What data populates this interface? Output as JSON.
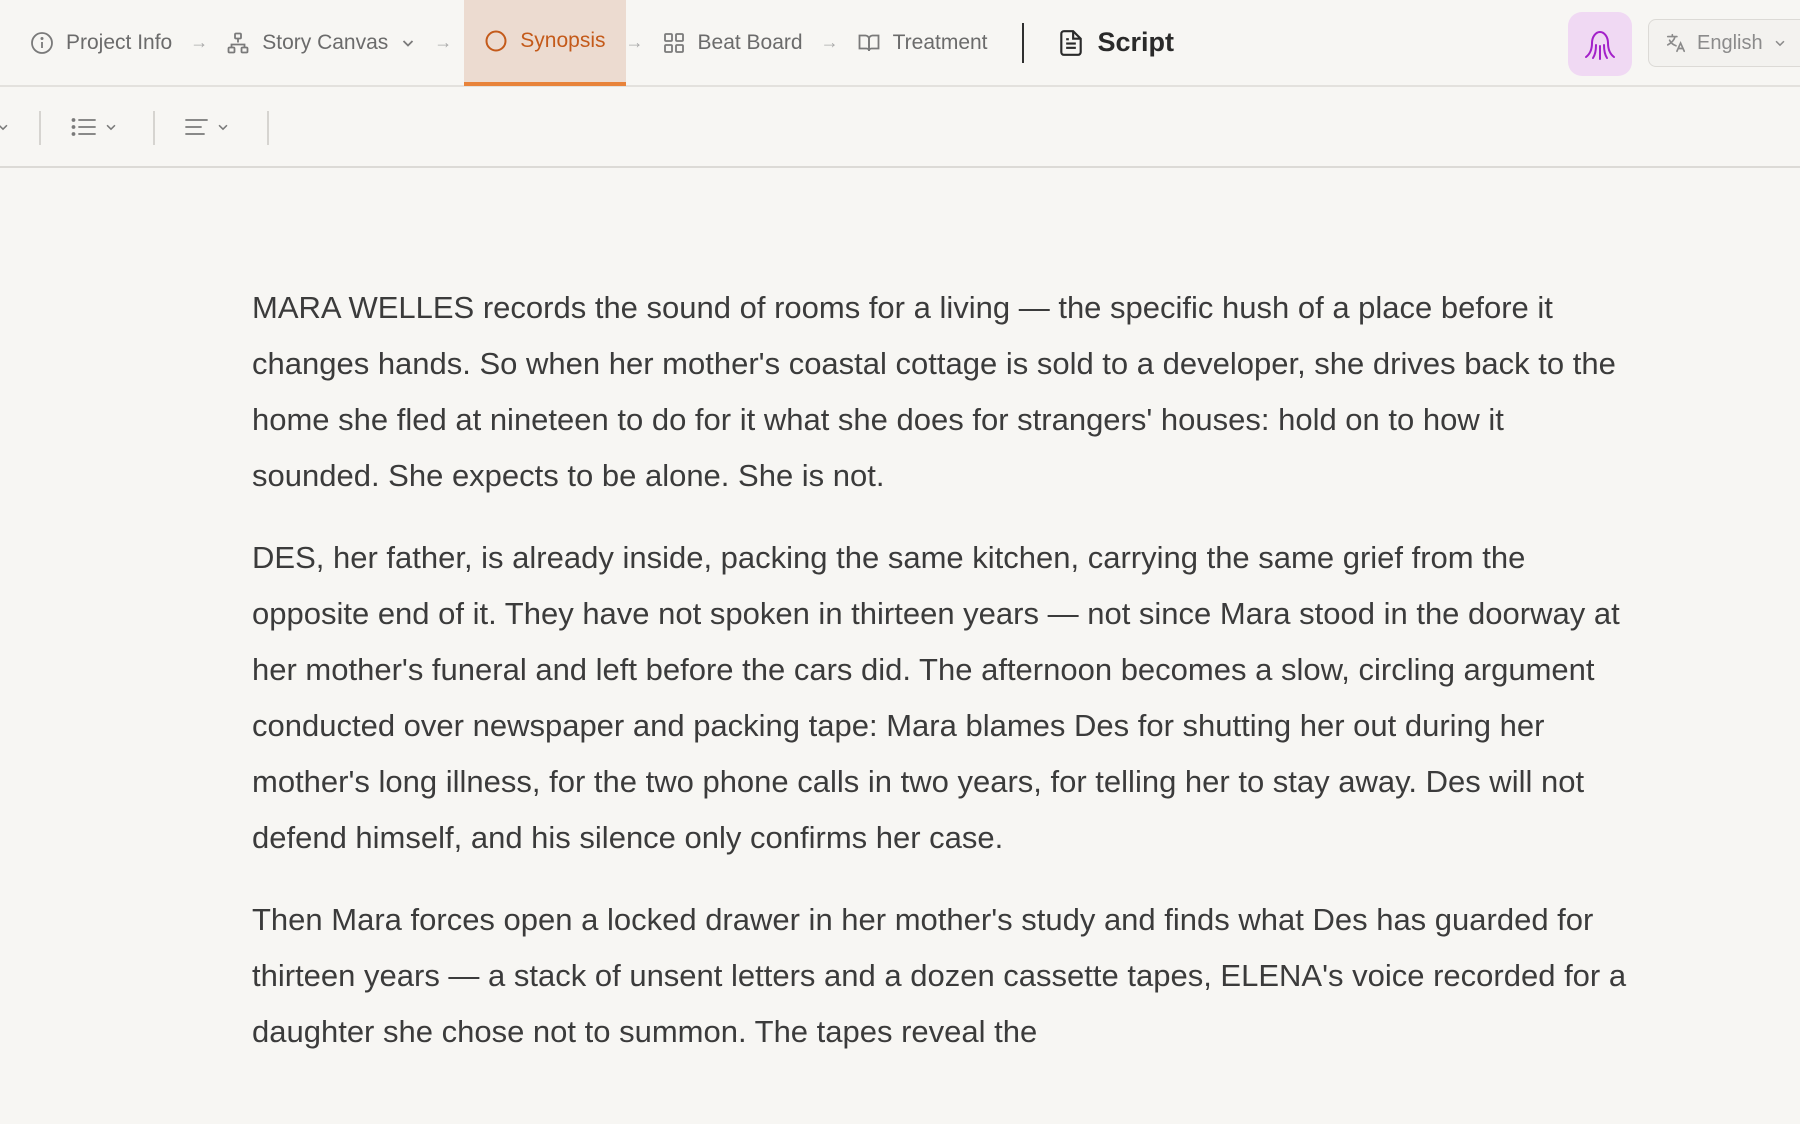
{
  "nav": {
    "items": [
      {
        "label": "Project Info",
        "icon": "info-icon"
      },
      {
        "label": "Story Canvas",
        "icon": "sitemap-icon",
        "has_dropdown": true
      },
      {
        "label": "Synopsis",
        "icon": "circle-icon",
        "active": true
      },
      {
        "label": "Beat Board",
        "icon": "grid-icon"
      },
      {
        "label": "Treatment",
        "icon": "book-open-icon"
      }
    ],
    "arrow": "→",
    "script_label": "Script"
  },
  "user": {
    "avatar_icon": "octopus-icon",
    "avatar_bg": "#f0d9f3",
    "avatar_color": "#a321c9"
  },
  "language": {
    "label": "English",
    "icon": "translate-icon"
  },
  "toolbar": {
    "items": [
      "list-format-dropdown",
      "align-dropdown"
    ]
  },
  "document": {
    "paragraphs": [
      "MARA WELLES records the sound of rooms for a living — the specific hush of a place before it changes hands. So when her mother's coastal cottage is sold to a developer, she drives back to the home she fled at nineteen to do for it what she does for strangers' houses: hold on to how it sounded. She expects to be alone. She is not.",
      "DES, her father, is already inside, packing the same kitchen, carrying the same grief from the opposite end of it. They have not spoken in thirteen years — not since Mara stood in the doorway at her mother's funeral and left before the cars did. The afternoon becomes a slow, circling argument conducted over newspaper and packing tape: Mara blames Des for shutting her out during her mother's long illness, for the two phone calls in two years, for telling her to stay away. Des will not defend himself, and his silence only confirms her case.",
      "Then Mara forces open a locked drawer in her mother's study and finds what Des has guarded for thirteen years — a stack of unsent letters and a dozen cassette tapes, ELENA's voice recorded for a daughter she chose not to summon. The tapes reveal the"
    ]
  },
  "colors": {
    "accent": "#c45a1a",
    "accent_underline": "#e8833a",
    "active_bg": "#ecdbd0",
    "background": "#f7f6f3"
  }
}
